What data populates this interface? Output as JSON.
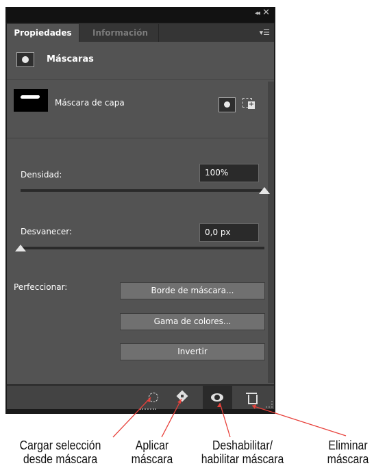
{
  "titlebar": {
    "collapse_glyph": "◂◂",
    "close_glyph": "✕"
  },
  "tabs": [
    {
      "label": "Propiedades",
      "active": true
    },
    {
      "label": "Información",
      "active": false
    }
  ],
  "panel_menu_icon": "panel-menu-icon",
  "panel_title": "Máscaras",
  "layer": {
    "label": "Máscara de capa"
  },
  "density": {
    "label": "Densidad:",
    "value": "100%",
    "level": 1.0
  },
  "feather": {
    "label": "Desvanecer:",
    "value": "0,0 px",
    "level": 0.0
  },
  "refine": {
    "label": "Perfeccionar:",
    "buttons": [
      "Borde de máscara...",
      "Gama de colores...",
      "Invertir"
    ]
  },
  "bottom_icons": [
    "load-selection-icon",
    "apply-mask-icon",
    "toggle-mask-icon",
    "delete-mask-icon"
  ],
  "callouts": {
    "load": [
      "Cargar selección",
      "desde máscara"
    ],
    "apply": [
      "Aplicar",
      "máscara"
    ],
    "toggle": [
      "Deshabilitar/",
      "habilitar máscara"
    ],
    "delete": [
      "Eliminar",
      "máscara"
    ]
  },
  "colors": {
    "panel_bg": "#535353",
    "dark_bg": "#1a1a1a",
    "callout_line": "#e8413b"
  }
}
